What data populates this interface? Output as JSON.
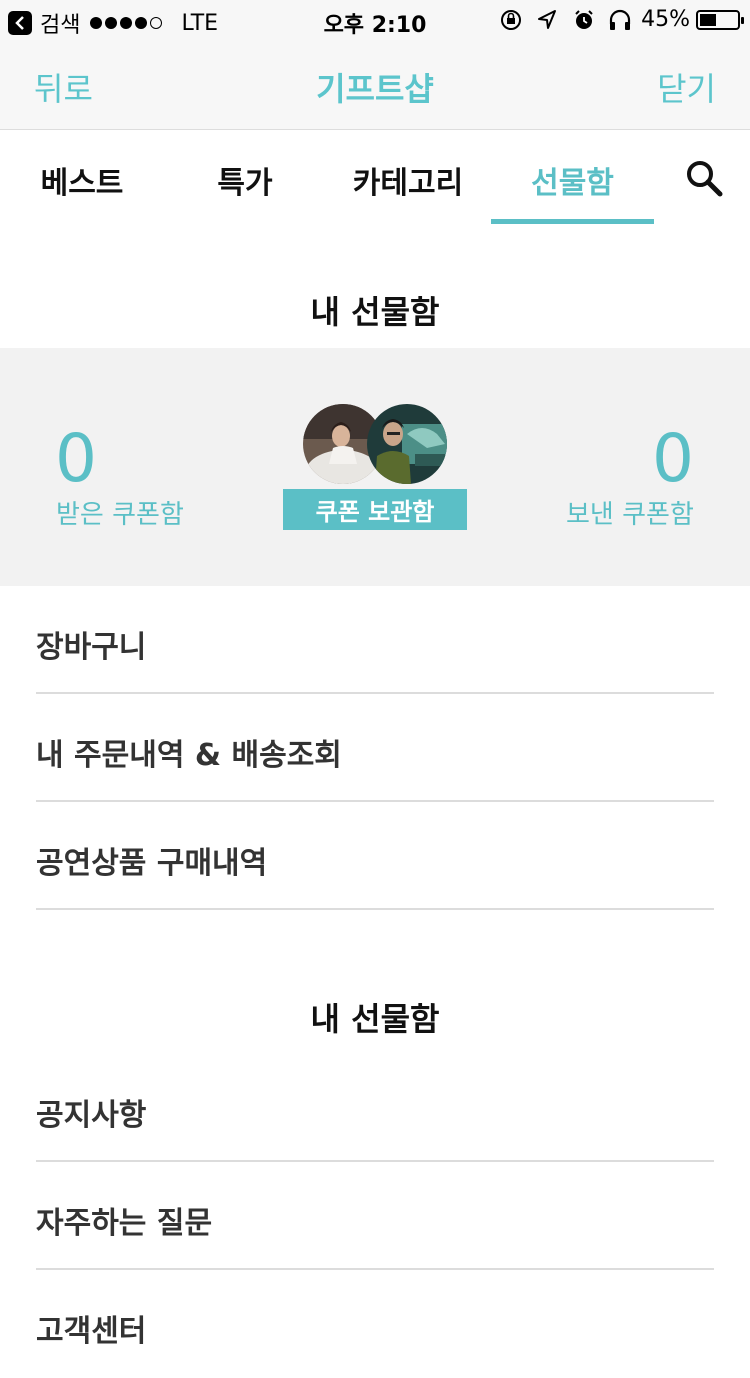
{
  "status_bar": {
    "back_app": "검색",
    "carrier": "LTE",
    "time": "오후 2:10",
    "battery": "45%",
    "battery_level": 0.45,
    "signal_bars_filled": 4,
    "signal_bars_total": 5
  },
  "nav": {
    "back_label": "뒤로",
    "title": "기프트샵",
    "close_label": "닫기"
  },
  "tabs": [
    {
      "label": "베스트"
    },
    {
      "label": "특가"
    },
    {
      "label": "카테고리"
    },
    {
      "label": "선물함"
    }
  ],
  "active_tab": "선물함",
  "gift_box": {
    "title": "내 선물함",
    "received_count": "0",
    "received_label": "받은 쿠폰함",
    "storage_button": "쿠폰 보관함",
    "sent_count": "0",
    "sent_label": "보낸 쿠폰함"
  },
  "menu": [
    {
      "label": "장바구니"
    },
    {
      "label": "내 주문내역 & 배송조회"
    },
    {
      "label": "공연상품 구매내역"
    }
  ],
  "support": {
    "title": "내 선물함",
    "items": [
      {
        "label": "공지사항"
      },
      {
        "label": "자주하는 질문"
      },
      {
        "label": "고객센터"
      }
    ]
  },
  "colors": {
    "accent": "#5bbfc6",
    "panel_bg": "#f2f2f2",
    "nav_bg": "#f7f7f7"
  }
}
